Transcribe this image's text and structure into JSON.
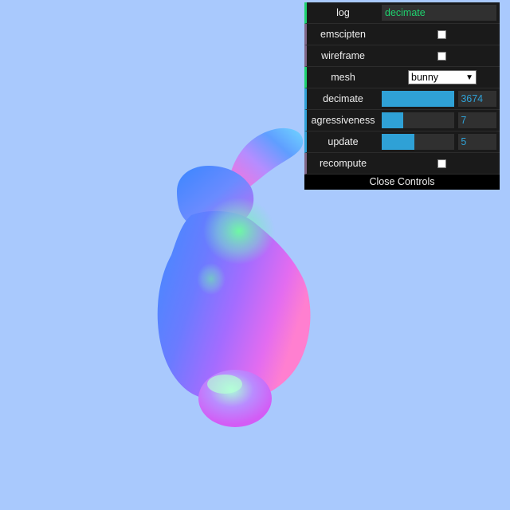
{
  "colors": {
    "background": "#a9c9fd",
    "panel": "#1a1a1a",
    "string_accent": "#1ed36f",
    "number_accent": "#2fa1d6"
  },
  "gui": {
    "log": {
      "label": "log",
      "value": "decimate"
    },
    "emscipten": {
      "label": "emscipten",
      "checked": false
    },
    "wireframe": {
      "label": "wireframe",
      "checked": false
    },
    "mesh": {
      "label": "mesh",
      "selected": "bunny"
    },
    "decimate": {
      "label": "decimate",
      "value": "3674",
      "fill_fraction": 1.0
    },
    "agressiveness": {
      "label": "agressiveness",
      "value": "7",
      "fill_fraction": 0.3
    },
    "update": {
      "label": "update",
      "value": "5",
      "fill_fraction": 0.45
    },
    "recompute": {
      "label": "recompute",
      "checked": false
    },
    "close_label": "Close Controls"
  }
}
